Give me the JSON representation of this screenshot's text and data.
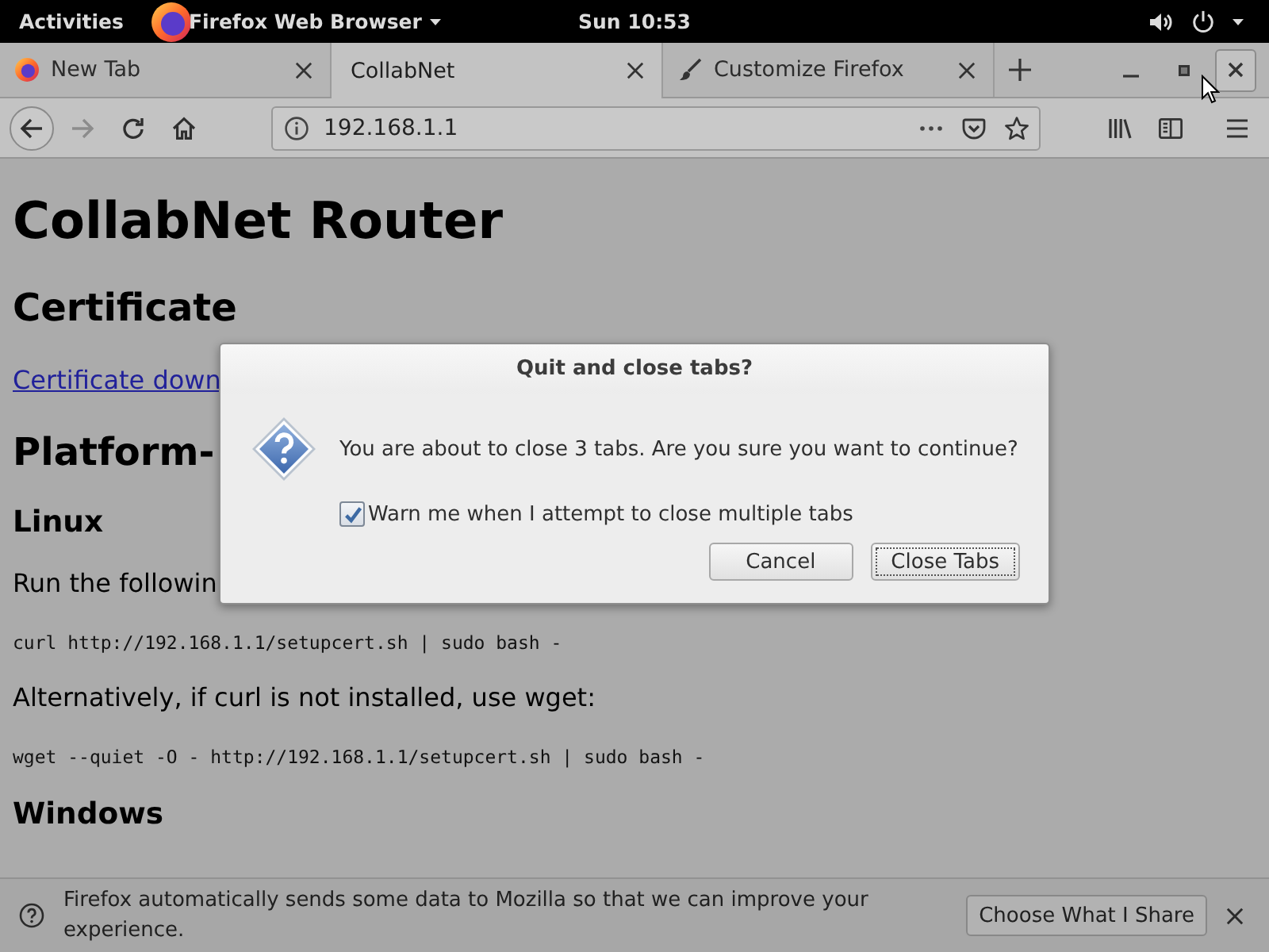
{
  "top_bar": {
    "activities": "Activities",
    "app_menu": "Firefox Web Browser",
    "clock": "Sun 10:53"
  },
  "tabs": [
    {
      "kind": "logo",
      "label": "New Tab",
      "selected": false
    },
    {
      "kind": "plain",
      "label": "CollabNet",
      "selected": true
    },
    {
      "kind": "brush",
      "label": "Customize Firefox",
      "selected": false
    }
  ],
  "window_controls": [
    {
      "kind": "minimize",
      "hovered": false
    },
    {
      "kind": "maximize",
      "hovered": false
    },
    {
      "kind": "close",
      "hovered": true
    }
  ],
  "nav_buttons": [
    {
      "kind": "back",
      "disabled": false
    },
    {
      "kind": "forward",
      "disabled": true
    },
    {
      "kind": "reload",
      "disabled": false
    },
    {
      "kind": "home",
      "disabled": false
    }
  ],
  "address_bar": {
    "value": "192.168.1.1"
  },
  "page": [
    {
      "kind": "h1",
      "text": "CollabNet Router"
    },
    {
      "kind": "h2",
      "text": "Certificate"
    },
    {
      "kind": "link",
      "text": "Certificate down"
    },
    {
      "kind": "h2",
      "text": "Platform-"
    },
    {
      "kind": "h3",
      "text": "Linux"
    },
    {
      "kind": "p",
      "text": "Run the followin"
    },
    {
      "kind": "code",
      "text": "curl http://192.168.1.1/setupcert.sh | sudo bash -"
    },
    {
      "kind": "p",
      "text": "Alternatively, if curl is not installed, use wget:"
    },
    {
      "kind": "code",
      "text": "wget --quiet -O - http://192.168.1.1/setupcert.sh | sudo bash -"
    },
    {
      "kind": "h3",
      "text": "Windows"
    }
  ],
  "dialog": {
    "title": "Quit and close tabs?",
    "message": "You are about to close 3 tabs. Are you sure you want to continue?",
    "checkbox": {
      "label": "Warn me when I attempt to close multiple tabs",
      "checked": true
    },
    "buttons": [
      {
        "label": "Cancel",
        "focused": false
      },
      {
        "label": "Close Tabs",
        "focused": true
      }
    ]
  },
  "notification": {
    "message": "Firefox automatically sends some data to Mozilla so that we can improve your experience.",
    "button": "Choose What I Share"
  }
}
